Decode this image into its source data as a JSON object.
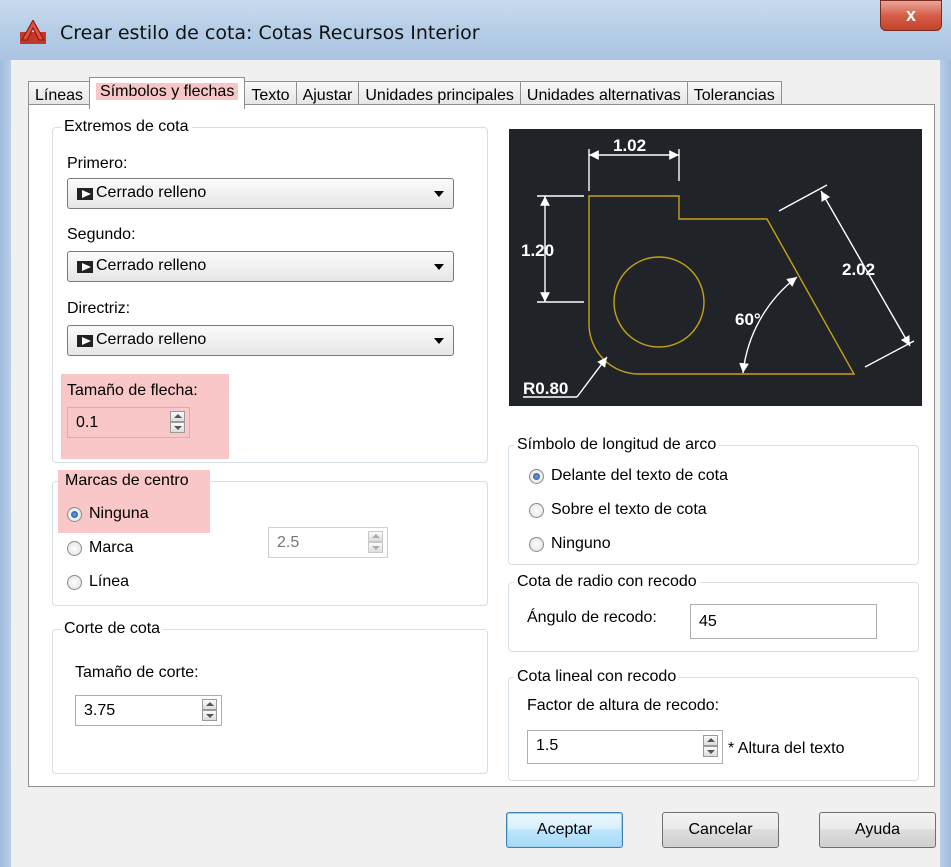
{
  "window": {
    "title": "Crear estilo de cota: Cotas Recursos Interior",
    "close_label": "x"
  },
  "tabs": [
    {
      "label": "Líneas"
    },
    {
      "label": "Símbolos y flechas"
    },
    {
      "label": "Texto"
    },
    {
      "label": "Ajustar"
    },
    {
      "label": "Unidades principales"
    },
    {
      "label": "Unidades alternativas"
    },
    {
      "label": "Tolerancias"
    }
  ],
  "extremos": {
    "title": "Extremos de cota",
    "primero_label": "Primero:",
    "primero_value": "Cerrado relleno",
    "segundo_label": "Segundo:",
    "segundo_value": "Cerrado relleno",
    "directriz_label": "Directriz:",
    "directriz_value": "Cerrado relleno",
    "tamano_label": "Tamaño de flecha:",
    "tamano_value": "0.1"
  },
  "marcas": {
    "title": "Marcas de centro",
    "options": [
      "Ninguna",
      "Marca",
      "Línea"
    ],
    "selected": "Ninguna",
    "size_value": "2.5"
  },
  "corte": {
    "title": "Corte de cota",
    "tamano_label": "Tamaño de corte:",
    "tamano_value": "3.75"
  },
  "preview": {
    "dim_top": "1.02",
    "dim_left": "1.20",
    "dim_right": "2.02",
    "angle": "60°",
    "radius": "R0.80"
  },
  "arco": {
    "title": "Símbolo de longitud de arco",
    "options": [
      "Delante del texto de cota",
      "Sobre el texto de cota",
      "Ninguno"
    ],
    "selected": "Delante del texto de cota"
  },
  "radio_recodo": {
    "title": "Cota de radio con recodo",
    "angulo_label": "Ángulo de recodo:",
    "angulo_value": "45"
  },
  "lineal_recodo": {
    "title": "Cota lineal con recodo",
    "factor_label": "Factor de altura de recodo:",
    "factor_value": "1.5",
    "suffix": "* Altura del texto"
  },
  "buttons": {
    "accept": "Aceptar",
    "cancel": "Cancelar",
    "help": "Ayuda"
  },
  "colors": {
    "highlight": "#f9c7c7",
    "preview_bg": "#202428",
    "preview_geometry": "#c8a014",
    "preview_dims": "#ffffff"
  }
}
